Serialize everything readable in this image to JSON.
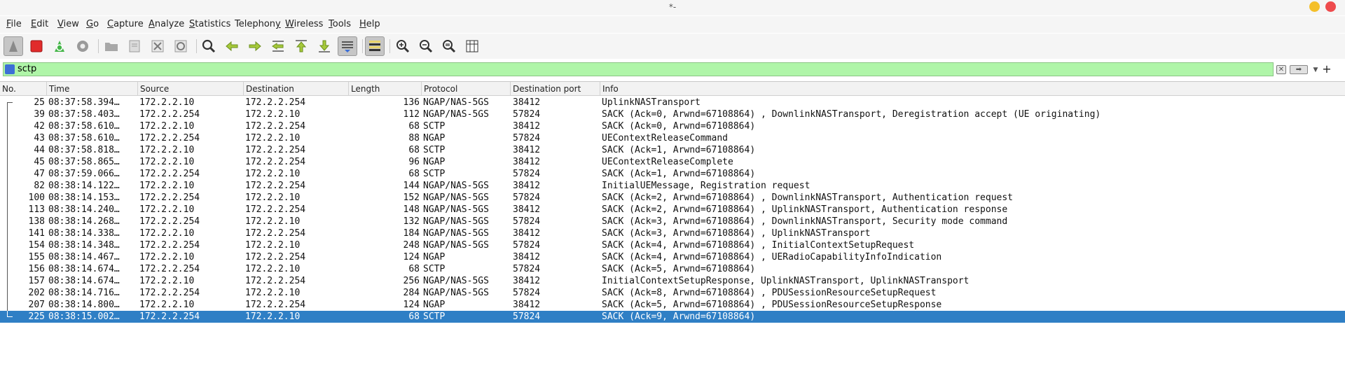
{
  "window": {
    "title": "*-"
  },
  "menu": [
    {
      "pre": "",
      "mn": "F",
      "post": "ile"
    },
    {
      "pre": "",
      "mn": "E",
      "post": "dit"
    },
    {
      "pre": "",
      "mn": "V",
      "post": "iew"
    },
    {
      "pre": "",
      "mn": "G",
      "post": "o"
    },
    {
      "pre": "",
      "mn": "C",
      "post": "apture"
    },
    {
      "pre": "",
      "mn": "A",
      "post": "nalyze"
    },
    {
      "pre": "",
      "mn": "S",
      "post": "tatistics"
    },
    {
      "pre": "Telephon",
      "mn": "y",
      "post": ""
    },
    {
      "pre": "",
      "mn": "W",
      "post": "ireless"
    },
    {
      "pre": "",
      "mn": "T",
      "post": "ools"
    },
    {
      "pre": "",
      "mn": "H",
      "post": "elp"
    }
  ],
  "toolbar": {
    "icons": [
      "start-capture-icon",
      "stop-capture-icon",
      "restart-capture-icon",
      "capture-options-icon",
      "open-file-icon",
      "save-file-icon",
      "close-file-icon",
      "reload-file-icon",
      "find-packet-icon",
      "go-back-icon",
      "go-forward-icon",
      "go-to-packet-icon",
      "first-packet-icon",
      "last-packet-icon",
      "auto-scroll-icon",
      "colorize-icon",
      "zoom-in-icon",
      "zoom-out-icon",
      "normal-size-icon",
      "resize-columns-icon"
    ]
  },
  "filter": {
    "value": "sctp"
  },
  "columns": {
    "no": "No.",
    "time": "Time",
    "source": "Source",
    "destination": "Destination",
    "length": "Length",
    "protocol": "Protocol",
    "dport": "Destination port",
    "info": "Info"
  },
  "packets": [
    {
      "no": "25",
      "time": "08:37:58.394…",
      "src": "172.2.2.10",
      "dst": "172.2.2.254",
      "len": "136",
      "proto": "NGAP/NAS-5GS",
      "port": "38412",
      "info": "UplinkNASTransport"
    },
    {
      "no": "39",
      "time": "08:37:58.403…",
      "src": "172.2.2.254",
      "dst": "172.2.2.10",
      "len": "112",
      "proto": "NGAP/NAS-5GS",
      "port": "57824",
      "info": "SACK (Ack=0, Arwnd=67108864) , DownlinkNASTransport, Deregistration accept (UE originating)"
    },
    {
      "no": "42",
      "time": "08:37:58.610…",
      "src": "172.2.2.10",
      "dst": "172.2.2.254",
      "len": "68",
      "proto": "SCTP",
      "port": "38412",
      "info": "SACK (Ack=0, Arwnd=67108864)"
    },
    {
      "no": "43",
      "time": "08:37:58.610…",
      "src": "172.2.2.254",
      "dst": "172.2.2.10",
      "len": "88",
      "proto": "NGAP",
      "port": "57824",
      "info": "UEContextReleaseCommand"
    },
    {
      "no": "44",
      "time": "08:37:58.818…",
      "src": "172.2.2.10",
      "dst": "172.2.2.254",
      "len": "68",
      "proto": "SCTP",
      "port": "38412",
      "info": "SACK (Ack=1, Arwnd=67108864)"
    },
    {
      "no": "45",
      "time": "08:37:58.865…",
      "src": "172.2.2.10",
      "dst": "172.2.2.254",
      "len": "96",
      "proto": "NGAP",
      "port": "38412",
      "info": "UEContextReleaseComplete"
    },
    {
      "no": "47",
      "time": "08:37:59.066…",
      "src": "172.2.2.254",
      "dst": "172.2.2.10",
      "len": "68",
      "proto": "SCTP",
      "port": "57824",
      "info": "SACK (Ack=1, Arwnd=67108864)"
    },
    {
      "no": "82",
      "time": "08:38:14.122…",
      "src": "172.2.2.10",
      "dst": "172.2.2.254",
      "len": "144",
      "proto": "NGAP/NAS-5GS",
      "port": "38412",
      "info": "InitialUEMessage, Registration request"
    },
    {
      "no": "100",
      "time": "08:38:14.153…",
      "src": "172.2.2.254",
      "dst": "172.2.2.10",
      "len": "152",
      "proto": "NGAP/NAS-5GS",
      "port": "57824",
      "info": "SACK (Ack=2, Arwnd=67108864) , DownlinkNASTransport, Authentication request"
    },
    {
      "no": "113",
      "time": "08:38:14.240…",
      "src": "172.2.2.10",
      "dst": "172.2.2.254",
      "len": "148",
      "proto": "NGAP/NAS-5GS",
      "port": "38412",
      "info": "SACK (Ack=2, Arwnd=67108864) , UplinkNASTransport, Authentication response"
    },
    {
      "no": "138",
      "time": "08:38:14.268…",
      "src": "172.2.2.254",
      "dst": "172.2.2.10",
      "len": "132",
      "proto": "NGAP/NAS-5GS",
      "port": "57824",
      "info": "SACK (Ack=3, Arwnd=67108864) , DownlinkNASTransport, Security mode command"
    },
    {
      "no": "141",
      "time": "08:38:14.338…",
      "src": "172.2.2.10",
      "dst": "172.2.2.254",
      "len": "184",
      "proto": "NGAP/NAS-5GS",
      "port": "38412",
      "info": "SACK (Ack=3, Arwnd=67108864) , UplinkNASTransport"
    },
    {
      "no": "154",
      "time": "08:38:14.348…",
      "src": "172.2.2.254",
      "dst": "172.2.2.10",
      "len": "248",
      "proto": "NGAP/NAS-5GS",
      "port": "57824",
      "info": "SACK (Ack=4, Arwnd=67108864) , InitialContextSetupRequest"
    },
    {
      "no": "155",
      "time": "08:38:14.467…",
      "src": "172.2.2.10",
      "dst": "172.2.2.254",
      "len": "124",
      "proto": "NGAP",
      "port": "38412",
      "info": "SACK (Ack=4, Arwnd=67108864) , UERadioCapabilityInfoIndication"
    },
    {
      "no": "156",
      "time": "08:38:14.674…",
      "src": "172.2.2.254",
      "dst": "172.2.2.10",
      "len": "68",
      "proto": "SCTP",
      "port": "57824",
      "info": "SACK (Ack=5, Arwnd=67108864)"
    },
    {
      "no": "157",
      "time": "08:38:14.674…",
      "src": "172.2.2.10",
      "dst": "172.2.2.254",
      "len": "256",
      "proto": "NGAP/NAS-5GS",
      "port": "38412",
      "info": "InitialContextSetupResponse, UplinkNASTransport, UplinkNASTransport"
    },
    {
      "no": "202",
      "time": "08:38:14.716…",
      "src": "172.2.2.254",
      "dst": "172.2.2.10",
      "len": "284",
      "proto": "NGAP/NAS-5GS",
      "port": "57824",
      "info": "SACK (Ack=8, Arwnd=67108864) , PDUSessionResourceSetupRequest"
    },
    {
      "no": "207",
      "time": "08:38:14.800…",
      "src": "172.2.2.10",
      "dst": "172.2.2.254",
      "len": "124",
      "proto": "NGAP",
      "port": "38412",
      "info": "SACK (Ack=5, Arwnd=67108864) , PDUSessionResourceSetupResponse"
    },
    {
      "no": "225",
      "time": "08:38:15.002…",
      "src": "172.2.2.254",
      "dst": "172.2.2.10",
      "len": "68",
      "proto": "SCTP",
      "port": "57824",
      "info": "SACK (Ack=9, Arwnd=67108864)",
      "selected": true
    }
  ]
}
